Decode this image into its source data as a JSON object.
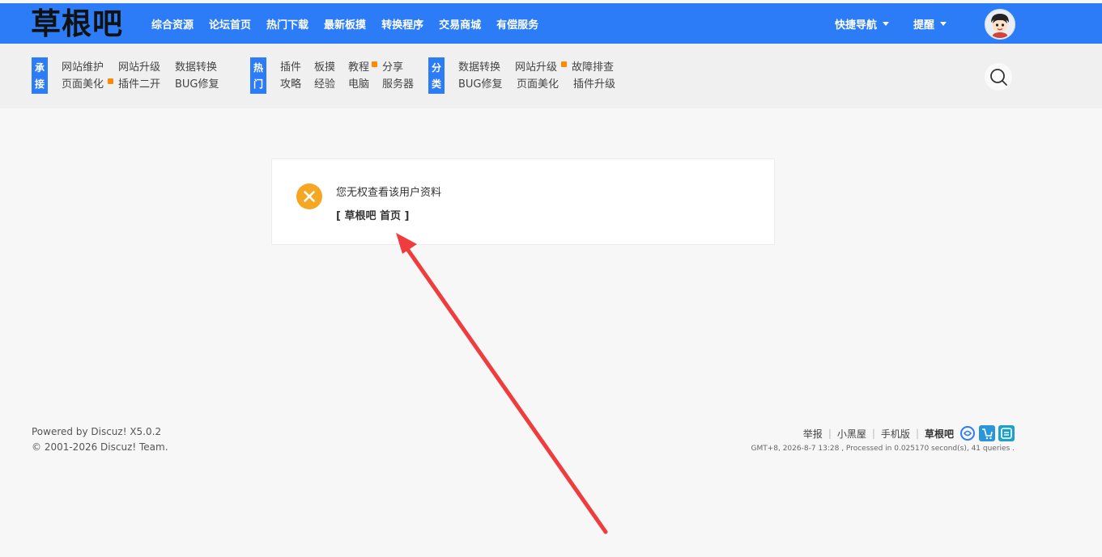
{
  "header": {
    "logo_text": "草根吧",
    "nav": [
      "综合资源",
      "论坛首页",
      "热门下载",
      "最新板摸",
      "转换程序",
      "交易商城",
      "有偿服务"
    ],
    "quick_nav": "快捷导航",
    "remind": "提醒"
  },
  "subnav": {
    "groups": [
      {
        "tag": [
          "承",
          "接"
        ],
        "row1": [
          "网站维护",
          "网站升级",
          "数据转换"
        ],
        "row2": [
          "页面美化",
          "插件二开",
          "BUG修复"
        ]
      },
      {
        "tag": [
          "热",
          "门"
        ],
        "row1": [
          "插件",
          "板摸",
          "教程",
          "分享"
        ],
        "row2": [
          "攻略",
          "经验",
          "电脑",
          "服务器"
        ]
      },
      {
        "tag": [
          "分",
          "类"
        ],
        "row1": [
          "数据转换",
          "网站升级",
          "故障排查"
        ],
        "row2": [
          "BUG修复",
          "页面美化",
          "插件升级"
        ]
      }
    ]
  },
  "message": {
    "text": "您无权查看该用户资料",
    "home_link": "[ 草根吧 首页 ]"
  },
  "footer": {
    "powered": "Powered by Discuz! X5.0.2",
    "copyright": "© 2001-2026 Discuz! Team.",
    "links": [
      "举报",
      "小黑屋",
      "手机版"
    ],
    "brand": "草根吧",
    "info": "GMT+8, 2026-8-7 13:28 , Processed in 0.025170 second(s), 41 queries ."
  },
  "colors": {
    "header_blue": "#2b7cf6",
    "error_orange": "#f5a623",
    "arrow_red": "#f03c3c",
    "badge_orange": "#ff8a00"
  }
}
